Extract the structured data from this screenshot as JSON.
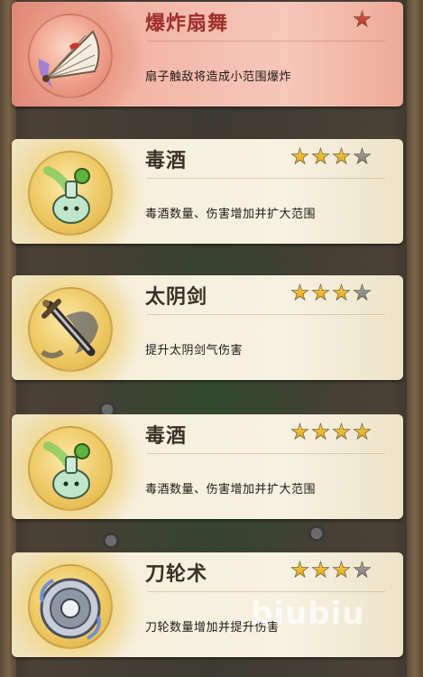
{
  "cards": [
    {
      "title": "爆炸扇舞",
      "description": "扇子触敌将造成小范围爆炸",
      "icon": "fan-icon",
      "stars": {
        "filled": 1,
        "total": 1,
        "color": "#c9382d"
      },
      "selected": true
    },
    {
      "title": "毒酒",
      "description": "毒酒数量、伤害增加并扩大范围",
      "icon": "poison-bottle-icon",
      "stars": {
        "filled": 3,
        "total": 4,
        "color": "#f0c23a"
      },
      "selected": false
    },
    {
      "title": "太阴剑",
      "description": "提升太阴剑气伤害",
      "icon": "sword-icon",
      "stars": {
        "filled": 3,
        "total": 4,
        "color": "#f0c23a"
      },
      "selected": false
    },
    {
      "title": "毒酒",
      "description": "毒酒数量、伤害增加并扩大范围",
      "icon": "poison-bottle-icon",
      "stars": {
        "filled": 4,
        "total": 4,
        "color": "#f0c23a"
      },
      "selected": false
    },
    {
      "title": "刀轮术",
      "description": "刀轮数量增加并提升伤害",
      "icon": "blade-wheel-icon",
      "stars": {
        "filled": 3,
        "total": 4,
        "color": "#f0c23a"
      },
      "selected": false
    }
  ],
  "watermark": "biubiu"
}
